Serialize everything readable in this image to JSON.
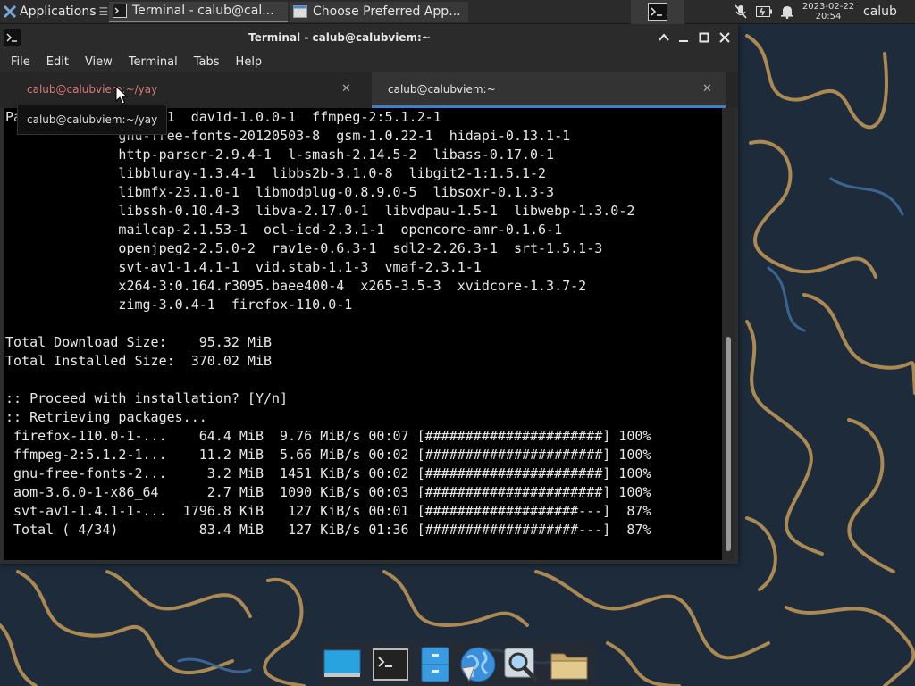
{
  "top_panel": {
    "apps_label": "Applications",
    "tasks": [
      {
        "label": "Terminal - calub@cal...",
        "icon": "terminal-icon",
        "active": true
      },
      {
        "label": "Choose Preferred App...",
        "icon": "window-icon",
        "active": false
      }
    ],
    "tray_icons": [
      "microphone-muted-icon",
      "battery-icon",
      "notifications-bell-icon"
    ],
    "clock_date": "2023-02-22",
    "clock_time": "20:54",
    "user": "calub"
  },
  "window": {
    "title": "Terminal - calub@calubviem:~",
    "menu": [
      "File",
      "Edit",
      "View",
      "Terminal",
      "Tabs",
      "Help"
    ],
    "tabs": [
      {
        "label": "calub@calubviem:~/yay",
        "active": false
      },
      {
        "label": "calub@calubviem:~",
        "active": true
      }
    ],
    "tooltip": "calub@calubviem:~/yay"
  },
  "console": {
    "lines": [
      "Pa            3.6.0-1  dav1d-1.0.0-1  ffmpeg-2:5.1.2-1",
      "              gnu-free-fonts-20120503-8  gsm-1.0.22-1  hidapi-0.13.1-1",
      "              http-parser-2.9.4-1  l-smash-2.14.5-2  libass-0.17.0-1",
      "              libbluray-1.3.4-1  libbs2b-3.1.0-8  libgit2-1:1.5.1-2",
      "              libmfx-23.1.0-1  libmodplug-0.8.9.0-5  libsoxr-0.1.3-3",
      "              libssh-0.10.4-3  libva-2.17.0-1  libvdpau-1.5-1  libwebp-1.3.0-2",
      "              mailcap-2.1.53-1  ocl-icd-2.3.1-1  opencore-amr-0.1.6-1",
      "              openjpeg2-2.5.0-2  rav1e-0.6.3-1  sdl2-2.26.3-1  srt-1.5.1-3",
      "              svt-av1-1.4.1-1  vid.stab-1.1-3  vmaf-2.3.1-1",
      "              x264-3:0.164.r3095.baee400-4  x265-3.5-3  xvidcore-1.3.7-2",
      "              zimg-3.0.4-1  firefox-110.0-1",
      "",
      "Total Download Size:    95.32 MiB",
      "Total Installed Size:  370.02 MiB",
      "",
      ":: Proceed with installation? [Y/n]",
      ":: Retrieving packages...",
      " firefox-110.0-1-...    64.4 MiB  9.76 MiB/s 00:07 [######################] 100%",
      " ffmpeg-2:5.1.2-1...    11.2 MiB  5.66 MiB/s 00:02 [######################] 100%",
      " gnu-free-fonts-2...     3.2 MiB  1451 KiB/s 00:02 [######################] 100%",
      " aom-3.6.0-1-x86_64      2.7 MiB  1090 KiB/s 00:03 [######################] 100%",
      " svt-av1-1.4.1-1-...  1796.8 KiB   127 KiB/s 00:01 [###################---]  87%",
      " Total ( 4/34)          83.4 MiB   127 KiB/s 01:36 [###################---]  87%"
    ]
  },
  "dock": {
    "items": [
      "show-desktop-icon",
      "terminal-icon",
      "file-manager-icon",
      "web-browser-icon",
      "app-finder-icon",
      "folder-icon"
    ]
  },
  "colors": {
    "panel_bg": "#2b2b2b",
    "console_bg": "#000000",
    "console_fg": "#e8e8e8",
    "inactive_tab_fg": "#d47a7a",
    "active_tab_indicator": "#3d7fd0"
  }
}
